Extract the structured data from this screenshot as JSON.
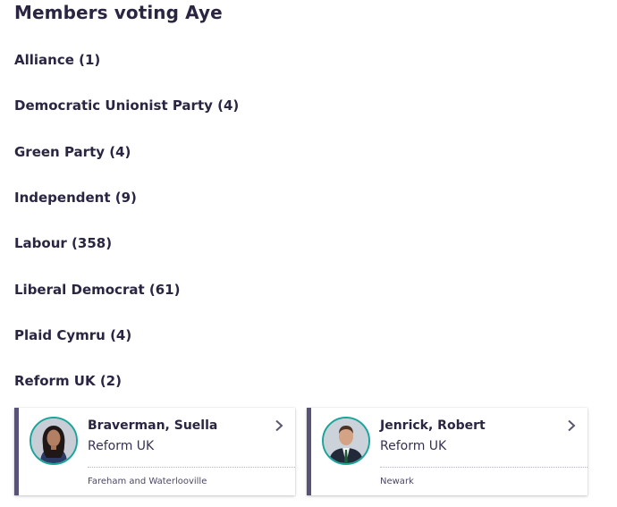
{
  "heading": "Members voting Aye",
  "parties": [
    {
      "label": "Alliance (1)"
    },
    {
      "label": "Democratic Unionist Party (4)"
    },
    {
      "label": "Green Party (4)"
    },
    {
      "label": "Independent (9)"
    },
    {
      "label": "Labour (358)"
    },
    {
      "label": "Liberal Democrat (61)"
    },
    {
      "label": "Plaid Cymru (4)"
    },
    {
      "label": "Reform UK (2)"
    }
  ],
  "members": [
    {
      "name": "Braverman, Suella",
      "party": "Reform UK",
      "constituency": "Fareham and Waterlooville",
      "party_color": "#5a5378"
    },
    {
      "name": "Jenrick, Robert",
      "party": "Reform UK",
      "constituency": "Newark",
      "party_color": "#5a5378"
    }
  ],
  "colors": {
    "text": "#2b2542",
    "avatar_ring": "#1aa59b",
    "party_bar": "#5a5378"
  }
}
